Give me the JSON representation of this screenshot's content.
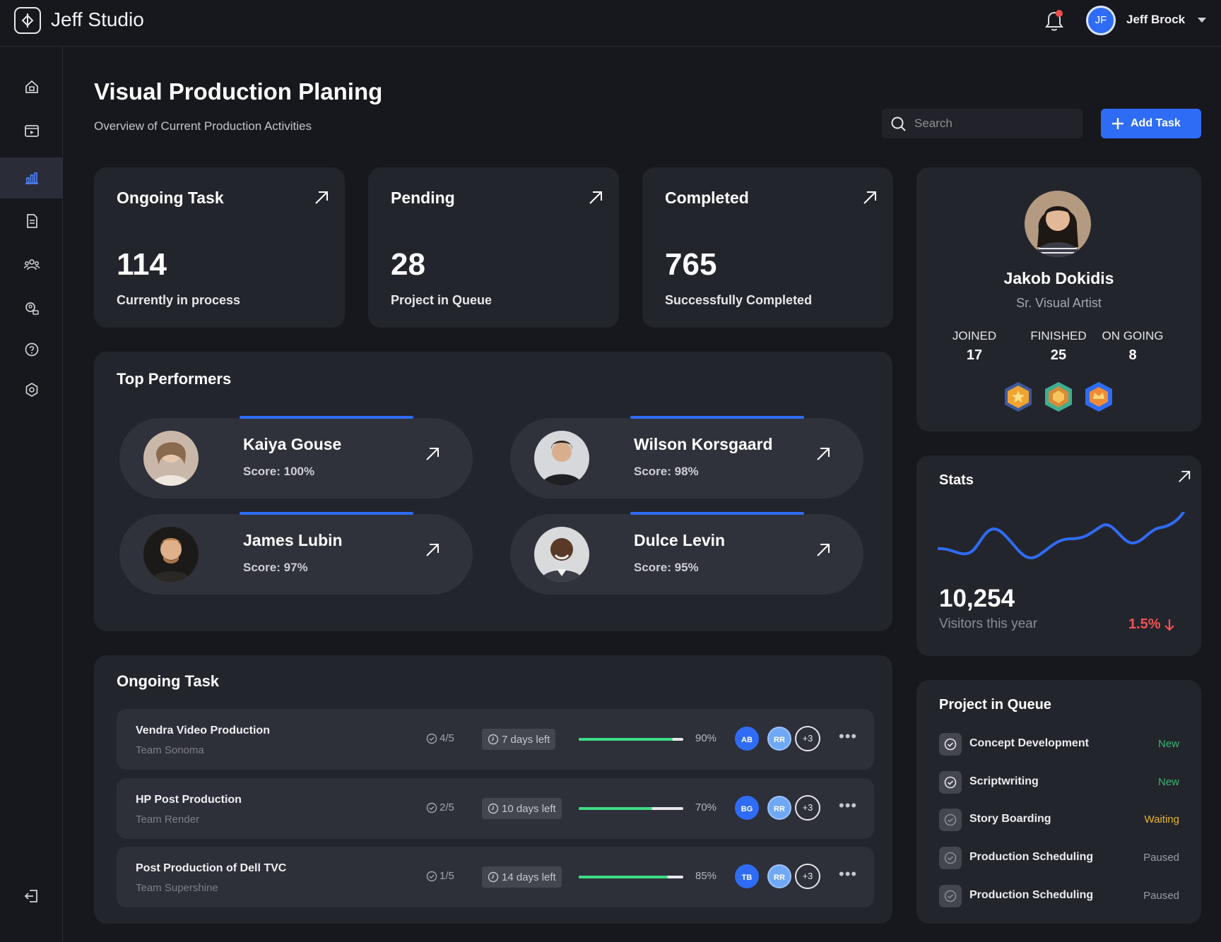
{
  "app": {
    "title": "Jeff Studio"
  },
  "user": {
    "initials": "JF",
    "name": "Jeff Brock"
  },
  "page": {
    "title": "Visual Production Planing",
    "subtitle": "Overview of Current Production Activities"
  },
  "search": {
    "placeholder": "Search",
    "value": ""
  },
  "actions": {
    "add_task_label": "Add Task"
  },
  "sidebar": {
    "items": [
      {
        "icon": "home-icon",
        "active": false
      },
      {
        "icon": "video-icon",
        "active": false
      },
      {
        "icon": "chart-icon",
        "active": true
      },
      {
        "icon": "document-icon",
        "active": false
      },
      {
        "icon": "team-icon",
        "active": false
      },
      {
        "icon": "user-search-icon",
        "active": false
      },
      {
        "icon": "help-icon",
        "active": false
      },
      {
        "icon": "settings-icon",
        "active": false
      }
    ],
    "logout_icon": "logout-icon"
  },
  "stat_cards": [
    {
      "title": "Ongoing Task",
      "value": "114",
      "description": "Currently in  process"
    },
    {
      "title": "Pending",
      "value": "28",
      "description": "Project in Queue"
    },
    {
      "title": "Completed",
      "value": "765",
      "description": "Successfully Completed"
    }
  ],
  "top_performers": {
    "title": "Top Performers",
    "people": [
      {
        "name": "Kaiya Gouse",
        "score": "Score: 100%"
      },
      {
        "name": "Wilson Korsgaard",
        "score": "Score: 98%"
      },
      {
        "name": "James Lubin",
        "score": "Score: 97%"
      },
      {
        "name": "Dulce Levin",
        "score": "Score: 95%"
      }
    ]
  },
  "ongoing_tasks": {
    "title": "Ongoing Task",
    "rows": [
      {
        "name": "Vendra Video Production",
        "team": "Team Sonoma",
        "checklist": "4/5",
        "days_left": "7 days left",
        "progress": 0.9,
        "progress_label": "90%",
        "assignees": [
          {
            "initials": "AB",
            "color": "#2f6cf6"
          },
          {
            "initials": "RR",
            "color": "#6fa8f5"
          }
        ],
        "more": "+3"
      },
      {
        "name": "HP Post Production",
        "team": "Team  Render",
        "checklist": "2/5",
        "days_left": "10 days left",
        "progress": 0.7,
        "progress_label": "70%",
        "assignees": [
          {
            "initials": "BG",
            "color": "#2f6cf6"
          },
          {
            "initials": "RR",
            "color": "#6fa8f5"
          }
        ],
        "more": "+3"
      },
      {
        "name": "Post Production of Dell TVC",
        "team": "Team Supershine",
        "checklist": "1/5",
        "days_left": "14 days left",
        "progress": 0.85,
        "progress_label": "85%",
        "assignees": [
          {
            "initials": "TB",
            "color": "#2f6cf6"
          },
          {
            "initials": "RR",
            "color": "#6fa8f5"
          }
        ],
        "more": "+3"
      }
    ]
  },
  "profile": {
    "name": "Jakob Dokidis",
    "role": "Sr. Visual Artist",
    "stats": [
      {
        "label": "JOINED",
        "value": "17"
      },
      {
        "label": "FINISHED",
        "value": "25"
      },
      {
        "label": "ON GOING",
        "value": "8"
      }
    ],
    "badges": [
      "star-badge-icon",
      "medal-badge-icon",
      "crown-badge-icon"
    ]
  },
  "stats": {
    "title": "Stats",
    "value": "10,254",
    "label": "Visitors this year",
    "change": "1.5%",
    "change_direction": "down",
    "line_color": "#2f6cf6"
  },
  "queue": {
    "title": "Project in Queue",
    "items": [
      {
        "label": "Concept Development",
        "status": "New",
        "status_color": "#3cb371"
      },
      {
        "label": "Scriptwriting",
        "status": "New",
        "status_color": "#3cb371"
      },
      {
        "label": "Story Boarding",
        "status": "Waiting",
        "status_color": "#e5b62d"
      },
      {
        "label": "Production Scheduling",
        "status": "Paused",
        "status_color": "#9a9ba2"
      },
      {
        "label": "Production Scheduling",
        "status": "Paused",
        "status_color": "#9a9ba2"
      }
    ]
  },
  "colors": {
    "accent": "#2f6cf6",
    "progress": "#3ddc84",
    "negative": "#f05252",
    "background": "#17181d",
    "card": "#23252d"
  }
}
